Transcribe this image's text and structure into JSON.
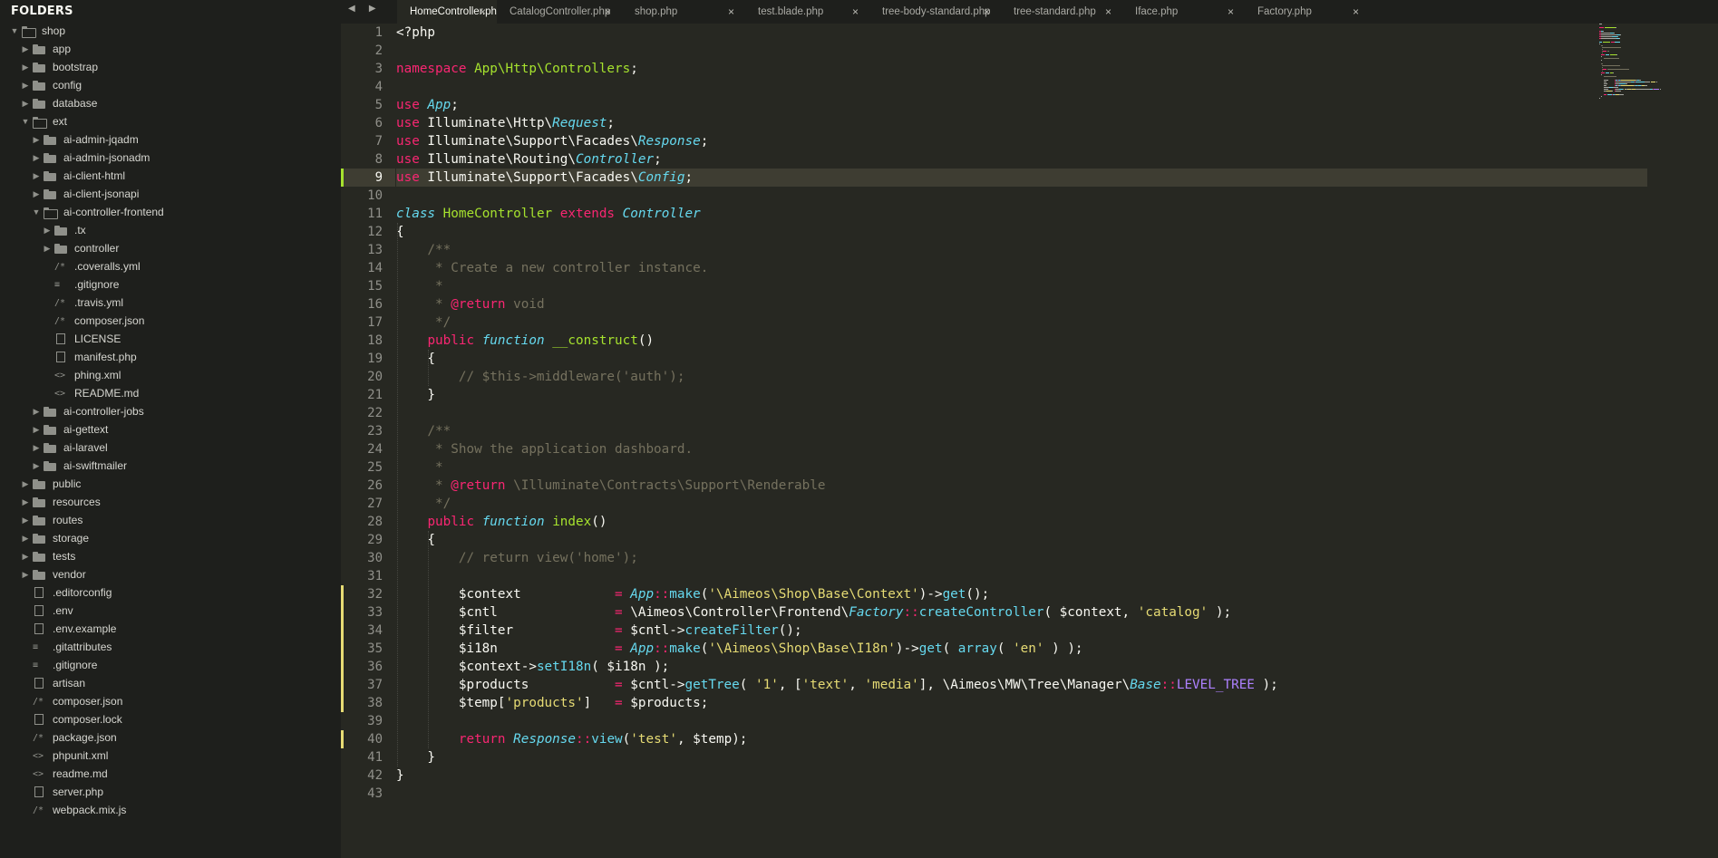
{
  "sidebar": {
    "header": "FOLDERS",
    "items": [
      {
        "label": "shop",
        "kind": "folder",
        "open": true,
        "depth": 0
      },
      {
        "label": "app",
        "kind": "folder",
        "open": false,
        "depth": 1
      },
      {
        "label": "bootstrap",
        "kind": "folder",
        "open": false,
        "depth": 1
      },
      {
        "label": "config",
        "kind": "folder",
        "open": false,
        "depth": 1
      },
      {
        "label": "database",
        "kind": "folder",
        "open": false,
        "depth": 1
      },
      {
        "label": "ext",
        "kind": "folder",
        "open": true,
        "depth": 1
      },
      {
        "label": "ai-admin-jqadm",
        "kind": "folder",
        "open": false,
        "depth": 2
      },
      {
        "label": "ai-admin-jsonadm",
        "kind": "folder",
        "open": false,
        "depth": 2
      },
      {
        "label": "ai-client-html",
        "kind": "folder",
        "open": false,
        "depth": 2
      },
      {
        "label": "ai-client-jsonapi",
        "kind": "folder",
        "open": false,
        "depth": 2
      },
      {
        "label": "ai-controller-frontend",
        "kind": "folder",
        "open": true,
        "depth": 2
      },
      {
        "label": ".tx",
        "kind": "folder",
        "open": false,
        "depth": 3
      },
      {
        "label": "controller",
        "kind": "folder",
        "open": false,
        "depth": 3
      },
      {
        "label": ".coveralls.yml",
        "kind": "file",
        "icon": "/*",
        "depth": 3
      },
      {
        "label": ".gitignore",
        "kind": "file",
        "icon": "≡",
        "depth": 3
      },
      {
        "label": ".travis.yml",
        "kind": "file",
        "icon": "/*",
        "depth": 3
      },
      {
        "label": "composer.json",
        "kind": "file",
        "icon": "/*",
        "depth": 3
      },
      {
        "label": "LICENSE",
        "kind": "file",
        "icon": "doc",
        "depth": 3
      },
      {
        "label": "manifest.php",
        "kind": "file",
        "icon": "doc",
        "depth": 3
      },
      {
        "label": "phing.xml",
        "kind": "file",
        "icon": "<>",
        "depth": 3
      },
      {
        "label": "README.md",
        "kind": "file",
        "icon": "<>",
        "depth": 3
      },
      {
        "label": "ai-controller-jobs",
        "kind": "folder",
        "open": false,
        "depth": 2
      },
      {
        "label": "ai-gettext",
        "kind": "folder",
        "open": false,
        "depth": 2
      },
      {
        "label": "ai-laravel",
        "kind": "folder",
        "open": false,
        "depth": 2
      },
      {
        "label": "ai-swiftmailer",
        "kind": "folder",
        "open": false,
        "depth": 2
      },
      {
        "label": "public",
        "kind": "folder",
        "open": false,
        "depth": 1
      },
      {
        "label": "resources",
        "kind": "folder",
        "open": false,
        "depth": 1
      },
      {
        "label": "routes",
        "kind": "folder",
        "open": false,
        "depth": 1
      },
      {
        "label": "storage",
        "kind": "folder",
        "open": false,
        "depth": 1
      },
      {
        "label": "tests",
        "kind": "folder",
        "open": false,
        "depth": 1
      },
      {
        "label": "vendor",
        "kind": "folder",
        "open": false,
        "depth": 1
      },
      {
        "label": ".editorconfig",
        "kind": "file",
        "icon": "doc",
        "depth": 1
      },
      {
        "label": ".env",
        "kind": "file",
        "icon": "doc",
        "depth": 1
      },
      {
        "label": ".env.example",
        "kind": "file",
        "icon": "doc",
        "depth": 1
      },
      {
        "label": ".gitattributes",
        "kind": "file",
        "icon": "≡",
        "depth": 1
      },
      {
        "label": ".gitignore",
        "kind": "file",
        "icon": "≡",
        "depth": 1
      },
      {
        "label": "artisan",
        "kind": "file",
        "icon": "doc",
        "depth": 1
      },
      {
        "label": "composer.json",
        "kind": "file",
        "icon": "/*",
        "depth": 1
      },
      {
        "label": "composer.lock",
        "kind": "file",
        "icon": "doc",
        "depth": 1
      },
      {
        "label": "package.json",
        "kind": "file",
        "icon": "/*",
        "depth": 1
      },
      {
        "label": "phpunit.xml",
        "kind": "file",
        "icon": "<>",
        "depth": 1
      },
      {
        "label": "readme.md",
        "kind": "file",
        "icon": "<>",
        "depth": 1
      },
      {
        "label": "server.php",
        "kind": "file",
        "icon": "doc",
        "depth": 1
      },
      {
        "label": "webpack.mix.js",
        "kind": "file",
        "icon": "/*",
        "depth": 1
      }
    ]
  },
  "tabs": [
    {
      "label": "HomeController.php",
      "active": true
    },
    {
      "label": "CatalogController.php",
      "active": false
    },
    {
      "label": "shop.php",
      "active": false
    },
    {
      "label": "test.blade.php",
      "active": false
    },
    {
      "label": "tree-body-standard.php",
      "active": false
    },
    {
      "label": "tree-standard.php",
      "active": false
    },
    {
      "label": "Iface.php",
      "active": false
    },
    {
      "label": "Factory.php",
      "active": false
    }
  ],
  "editor": {
    "current_line": 9,
    "gutter_marks": {
      "9": "add",
      "32": "mod",
      "33": "mod",
      "34": "mod",
      "35": "mod",
      "36": "mod",
      "37": "mod",
      "38": "mod",
      "40": "mod"
    },
    "lines": [
      [
        [
          "t",
          "<?php"
        ]
      ],
      [],
      [
        [
          "k",
          "namespace"
        ],
        [
          "t",
          " "
        ],
        [
          "g",
          "App\\Http\\Controllers"
        ],
        [
          "t",
          ";"
        ]
      ],
      [],
      [
        [
          "k",
          "use"
        ],
        [
          "t",
          " "
        ],
        [
          "sup",
          "App"
        ],
        [
          "t",
          ";"
        ]
      ],
      [
        [
          "k",
          "use"
        ],
        [
          "t",
          " Illuminate\\Http\\"
        ],
        [
          "sup",
          "Request"
        ],
        [
          "t",
          ";"
        ]
      ],
      [
        [
          "k",
          "use"
        ],
        [
          "t",
          " Illuminate\\Support\\Facades\\"
        ],
        [
          "sup",
          "Response"
        ],
        [
          "t",
          ";"
        ]
      ],
      [
        [
          "k",
          "use"
        ],
        [
          "t",
          " Illuminate\\Routing\\"
        ],
        [
          "sup",
          "Controller"
        ],
        [
          "t",
          ";"
        ]
      ],
      [
        [
          "k",
          "use"
        ],
        [
          "t",
          " Illuminate\\Support\\Facades\\"
        ],
        [
          "sup",
          "Config"
        ],
        [
          "t",
          ";"
        ]
      ],
      [],
      [
        [
          "sup",
          "class"
        ],
        [
          "t",
          " "
        ],
        [
          "g",
          "HomeController"
        ],
        [
          "t",
          " "
        ],
        [
          "k",
          "extends"
        ],
        [
          "t",
          " "
        ],
        [
          "sup",
          "Controller"
        ]
      ],
      [
        [
          "t",
          "{"
        ]
      ],
      [
        [
          "c",
          "    /**"
        ]
      ],
      [
        [
          "c",
          "     * Create a new controller instance."
        ]
      ],
      [
        [
          "c",
          "     *"
        ]
      ],
      [
        [
          "c",
          "     * "
        ],
        [
          "k",
          "@return"
        ],
        [
          "c",
          " void"
        ]
      ],
      [
        [
          "c",
          "     */"
        ]
      ],
      [
        [
          "t",
          "    "
        ],
        [
          "k",
          "public"
        ],
        [
          "t",
          " "
        ],
        [
          "sup",
          "function"
        ],
        [
          "t",
          " "
        ],
        [
          "g",
          "__construct"
        ],
        [
          "t",
          "()"
        ]
      ],
      [
        [
          "t",
          "    {"
        ]
      ],
      [
        [
          "c",
          "        // $this->middleware('auth');"
        ]
      ],
      [
        [
          "t",
          "    }"
        ]
      ],
      [],
      [
        [
          "c",
          "    /**"
        ]
      ],
      [
        [
          "c",
          "     * Show the application dashboard."
        ]
      ],
      [
        [
          "c",
          "     *"
        ]
      ],
      [
        [
          "c",
          "     * "
        ],
        [
          "k",
          "@return"
        ],
        [
          "c",
          " \\Illuminate\\Contracts\\Support\\Renderable"
        ]
      ],
      [
        [
          "c",
          "     */"
        ]
      ],
      [
        [
          "t",
          "    "
        ],
        [
          "k",
          "public"
        ],
        [
          "t",
          " "
        ],
        [
          "sup",
          "function"
        ],
        [
          "t",
          " "
        ],
        [
          "g",
          "index"
        ],
        [
          "t",
          "()"
        ]
      ],
      [
        [
          "t",
          "    {"
        ]
      ],
      [
        [
          "c",
          "        // return view('home');"
        ]
      ],
      [],
      [
        [
          "t",
          "        $context            "
        ],
        [
          "k",
          "="
        ],
        [
          "t",
          " "
        ],
        [
          "sup",
          "App"
        ],
        [
          "k",
          "::"
        ],
        [
          "f",
          "make"
        ],
        [
          "t",
          "("
        ],
        [
          "s",
          "'\\Aimeos\\Shop\\Base\\Context'"
        ],
        [
          "t",
          ")->"
        ],
        [
          "f",
          "get"
        ],
        [
          "t",
          "();"
        ]
      ],
      [
        [
          "t",
          "        $cntl               "
        ],
        [
          "k",
          "="
        ],
        [
          "t",
          " \\Aimeos\\Controller\\Frontend\\"
        ],
        [
          "sup",
          "Factory"
        ],
        [
          "k",
          "::"
        ],
        [
          "f",
          "createController"
        ],
        [
          "t",
          "( $context, "
        ],
        [
          "s",
          "'catalog'"
        ],
        [
          "t",
          " );"
        ]
      ],
      [
        [
          "t",
          "        $filter             "
        ],
        [
          "k",
          "="
        ],
        [
          "t",
          " $cntl->"
        ],
        [
          "f",
          "createFilter"
        ],
        [
          "t",
          "();"
        ]
      ],
      [
        [
          "t",
          "        $i18n               "
        ],
        [
          "k",
          "="
        ],
        [
          "t",
          " "
        ],
        [
          "sup",
          "App"
        ],
        [
          "k",
          "::"
        ],
        [
          "f",
          "make"
        ],
        [
          "t",
          "("
        ],
        [
          "s",
          "'\\Aimeos\\Shop\\Base\\I18n'"
        ],
        [
          "t",
          ")->"
        ],
        [
          "f",
          "get"
        ],
        [
          "t",
          "( "
        ],
        [
          "f",
          "array"
        ],
        [
          "t",
          "( "
        ],
        [
          "s",
          "'en'"
        ],
        [
          "t",
          " ) );"
        ]
      ],
      [
        [
          "t",
          "        $context->"
        ],
        [
          "f",
          "setI18n"
        ],
        [
          "t",
          "( $i18n );"
        ]
      ],
      [
        [
          "t",
          "        $products           "
        ],
        [
          "k",
          "="
        ],
        [
          "t",
          " $cntl->"
        ],
        [
          "f",
          "getTree"
        ],
        [
          "t",
          "( "
        ],
        [
          "s",
          "'1'"
        ],
        [
          "t",
          ", ["
        ],
        [
          "s",
          "'text'"
        ],
        [
          "t",
          ", "
        ],
        [
          "s",
          "'media'"
        ],
        [
          "t",
          "], \\Aimeos\\MW\\Tree\\Manager\\"
        ],
        [
          "sup",
          "Base"
        ],
        [
          "k",
          "::"
        ],
        [
          "cn",
          "LEVEL_TREE"
        ],
        [
          "t",
          " );"
        ]
      ],
      [
        [
          "t",
          "        $temp["
        ],
        [
          "s",
          "'products'"
        ],
        [
          "t",
          "]   "
        ],
        [
          "k",
          "="
        ],
        [
          "t",
          " $products;"
        ]
      ],
      [],
      [
        [
          "t",
          "        "
        ],
        [
          "k",
          "return"
        ],
        [
          "t",
          " "
        ],
        [
          "sup",
          "Response"
        ],
        [
          "k",
          "::"
        ],
        [
          "f",
          "view"
        ],
        [
          "t",
          "("
        ],
        [
          "s",
          "'test'"
        ],
        [
          "t",
          ", $temp);"
        ]
      ],
      [
        [
          "t",
          "    }"
        ]
      ],
      [
        [
          "t",
          "}"
        ]
      ],
      []
    ]
  }
}
